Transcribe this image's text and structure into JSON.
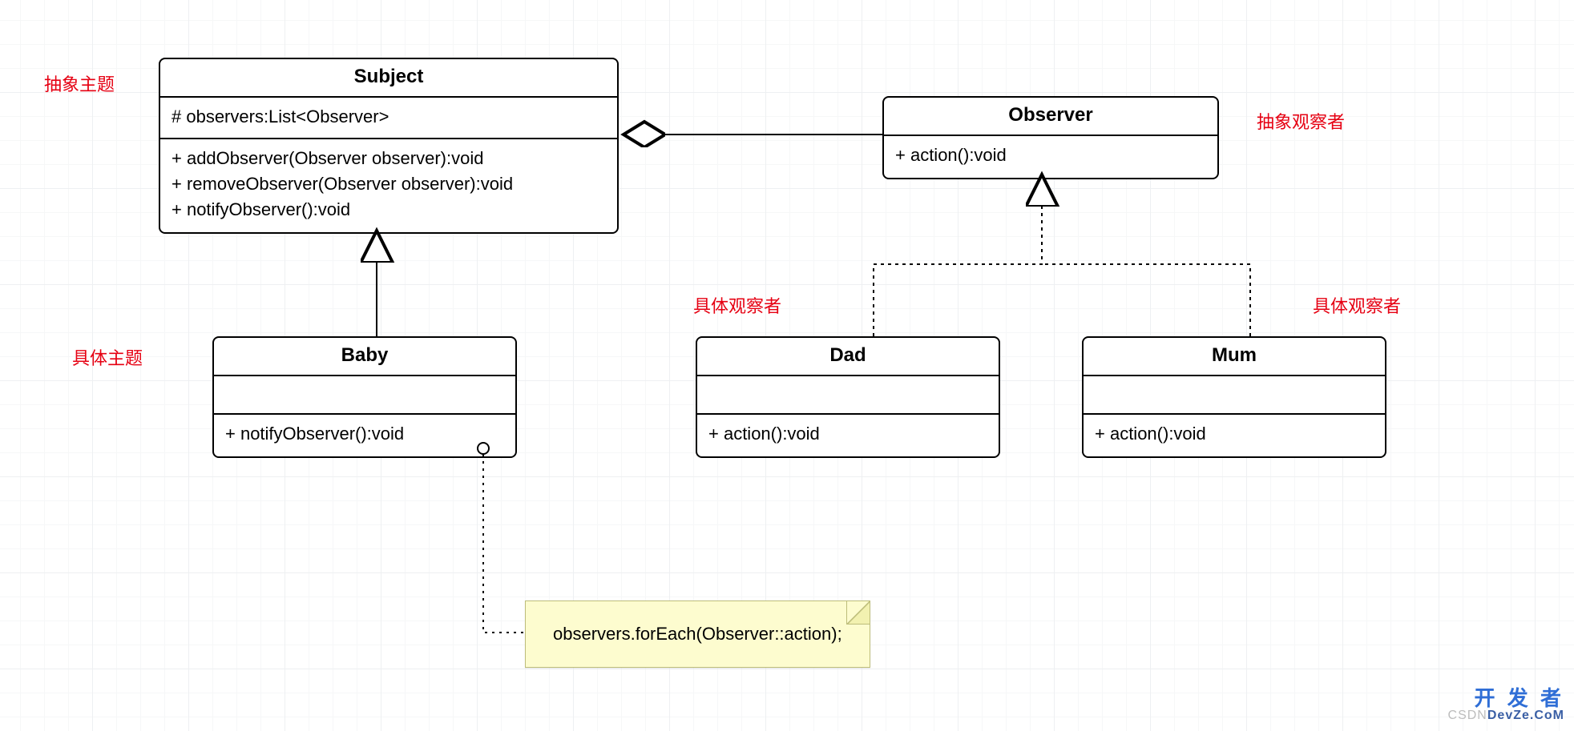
{
  "labels": {
    "abstract_subject": "抽象主题",
    "concrete_subject": "具体主题",
    "abstract_observer": "抽象观察者",
    "concrete_observer_left": "具体观察者",
    "concrete_observer_right": "具体观察者"
  },
  "classes": {
    "subject": {
      "name": "Subject",
      "attrs": [
        "# observers:List<Observer>"
      ],
      "ops": [
        "+ addObserver(Observer observer):void",
        "+ removeObserver(Observer observer):void",
        "+ notifyObserver():void"
      ]
    },
    "observer": {
      "name": "Observer",
      "attrs": [],
      "ops": [
        "+ action():void"
      ]
    },
    "baby": {
      "name": "Baby",
      "attrs": [],
      "ops": [
        "+ notifyObserver():void"
      ]
    },
    "dad": {
      "name": "Dad",
      "attrs": [],
      "ops": [
        "+ action():void"
      ]
    },
    "mum": {
      "name": "Mum",
      "attrs": [],
      "ops": [
        "+ action():void"
      ]
    }
  },
  "note": {
    "text": "observers.forEach(Observer::action);"
  },
  "watermark": {
    "line1": "开 发 者",
    "line2_prefix": "CSDN",
    "line2_brand_a": "DevZe",
    "line2_brand_b": ".CoM"
  }
}
